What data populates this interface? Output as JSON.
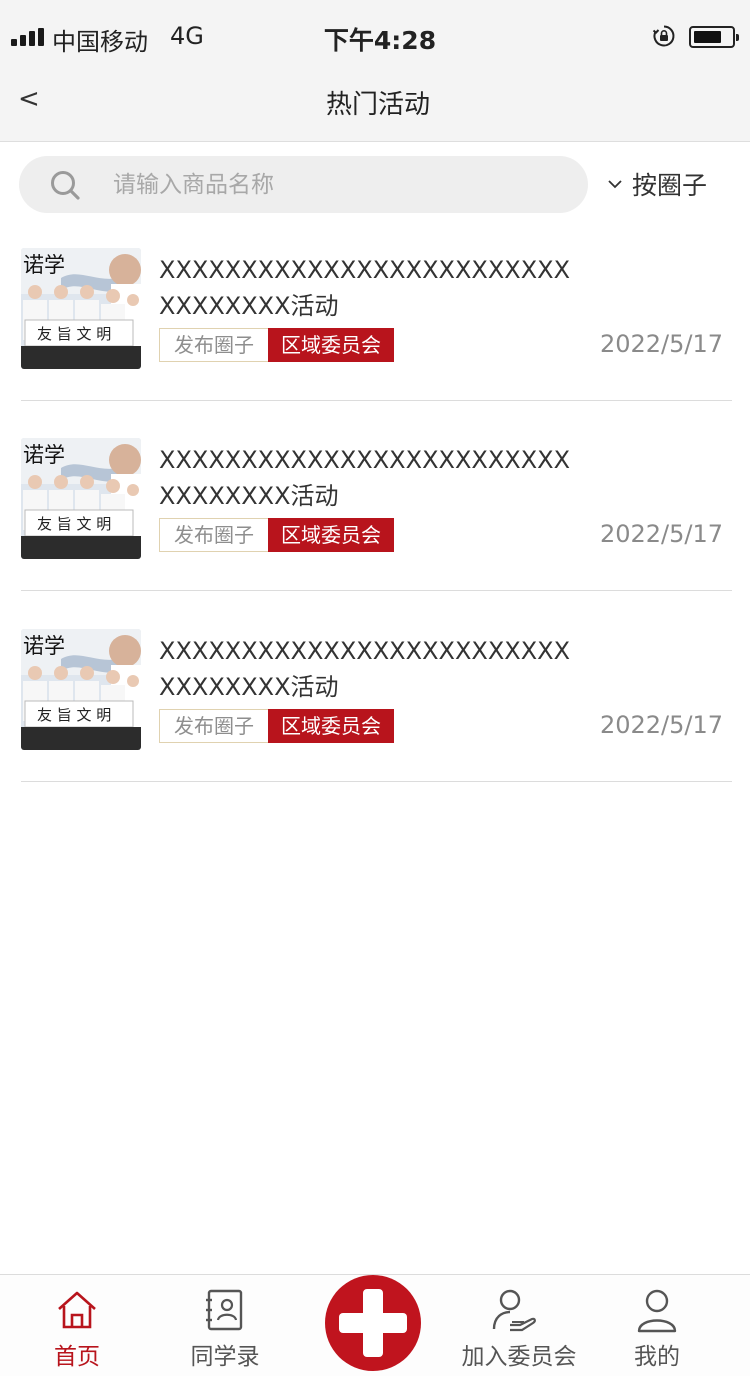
{
  "status_bar": {
    "carrier": "中国移动",
    "network": "4G",
    "time": "下午4:28",
    "battery_level": 0.75
  },
  "nav": {
    "back_label": "<",
    "title": "热门活动"
  },
  "search": {
    "placeholder": "请输入商品名称",
    "value": ""
  },
  "filter": {
    "label": "按圈子"
  },
  "activities": [
    {
      "title": "XXXXXXXXXXXXXXXXXXXXXXXXXXXXXXXXX活动",
      "tag_circle": "发布圈子",
      "tag_committee": "区域委员会",
      "date": "2022/5/17",
      "image_caption": "友 旨 文 明"
    },
    {
      "title": "XXXXXXXXXXXXXXXXXXXXXXXXXXXXXXXXX活动",
      "tag_circle": "发布圈子",
      "tag_committee": "区域委员会",
      "date": "2022/5/17",
      "image_caption": "友 旨 文 明"
    },
    {
      "title": "XXXXXXXXXXXXXXXXXXXXXXXXXXXXXXXXX活动",
      "tag_circle": "发布圈子",
      "tag_committee": "区域委员会",
      "date": "2022/5/17",
      "image_caption": "友 旨 文 明"
    }
  ],
  "tab_bar": {
    "home": "首页",
    "classmates": "同学录",
    "join_committee": "加入委员会",
    "mine": "我的"
  },
  "colors": {
    "accent": "#b8141c",
    "background": "#ffffff",
    "bar": "#f4f4f4"
  }
}
